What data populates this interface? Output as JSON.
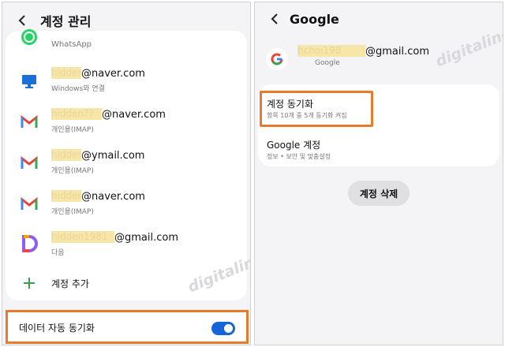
{
  "left": {
    "header": {
      "title": "계정 관리"
    },
    "accounts": [
      {
        "app": "WhatsApp",
        "email_masked": "",
        "email_suffix": "",
        "subtitle": "WhatsApp",
        "icon": "whatsapp-icon"
      },
      {
        "app": "Windows",
        "email_masked": "hidden",
        "email_suffix": "@naver.com",
        "subtitle": "Windows와 연결",
        "icon": "windows-monitor-icon"
      },
      {
        "app": "Gmail",
        "email_masked": "hidden??",
        "email_suffix": "@naver.com",
        "subtitle": "개인용(IMAP)",
        "icon": "gmail-icon"
      },
      {
        "app": "Gmail",
        "email_masked": "hidden",
        "email_suffix": "@ymail.com",
        "subtitle": "개인용(IMAP)",
        "icon": "gmail-icon"
      },
      {
        "app": "Gmail",
        "email_masked": "hidden",
        "email_suffix": "@naver.com",
        "subtitle": "개인용(IMAP)",
        "icon": "gmail-icon"
      },
      {
        "app": "Daum",
        "email_masked": "hidden1981",
        "email_suffix": "@gmail.com",
        "subtitle": "다음",
        "icon": "daum-icon"
      }
    ],
    "add_account": "계정 추가",
    "auto_sync": {
      "label": "데이터 자동 동기화",
      "enabled": true
    },
    "watermark": "digitaline"
  },
  "right": {
    "header": {
      "title": "Google"
    },
    "account": {
      "email_masked": "hchoi198",
      "email_suffix": "@gmail.com",
      "provider": "Google",
      "icon": "google-icon"
    },
    "sync": {
      "title": "계정 동기화",
      "subtitle": "항목 10개 중 5개 동기화 켜짐"
    },
    "google_account": {
      "title": "Google 계정",
      "subtitle": "정보 • 보안 및 맞춤설정"
    },
    "delete_button": "계정 삭제",
    "watermark": "digitaline"
  },
  "colors": {
    "accent": "#1565d8",
    "highlight_box": "#e57b2b",
    "mask": "#f6e7a9",
    "add_plus": "#3f9b4e"
  }
}
